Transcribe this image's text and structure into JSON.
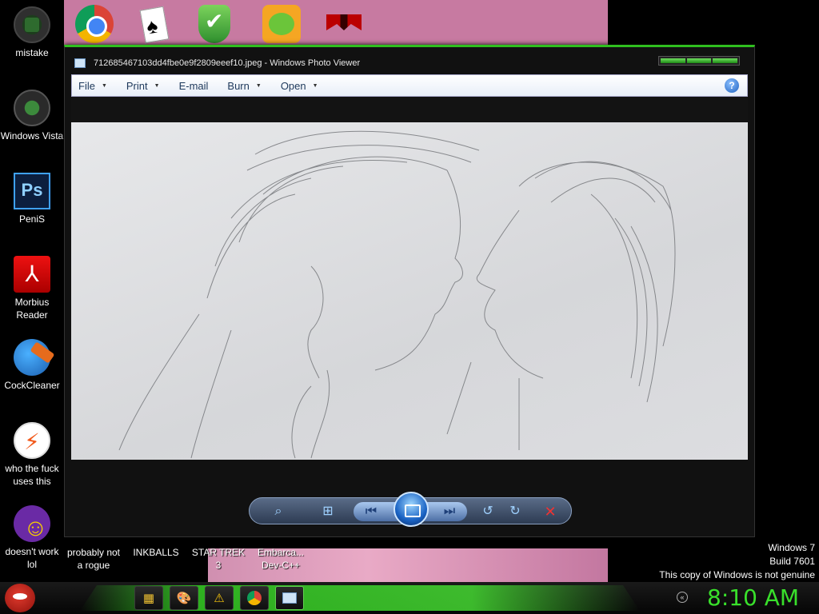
{
  "desktop_left": [
    {
      "label": "mistake",
      "icon": "mistake-icon"
    },
    {
      "label": "Windows Vista",
      "icon": "windows-vista-icon"
    },
    {
      "label": "PeniS",
      "icon": "photoshop-icon"
    },
    {
      "label": "Morbius Reader",
      "icon": "pdf-reader-icon"
    },
    {
      "label": "CockCleaner",
      "icon": "ccleaner-icon"
    },
    {
      "label": "who the fuck uses this",
      "icon": "bolt-app-icon"
    },
    {
      "label": "doesn't work lol",
      "icon": "yahoo-messenger-icon"
    }
  ],
  "desktop_top_icons": [
    "chrome-icon",
    "solitaire-icon",
    "shield-icon",
    "bad-piggies-icon",
    "flag-icon"
  ],
  "bottom_labels": [
    "probably not a rogue",
    "INKBALLS",
    "STAR TREK 3",
    "Embarca... Dev-C++"
  ],
  "window": {
    "title": "712685467103dd4fbe0e9f2809eeef10.jpeg - Windows Photo Viewer",
    "menu": [
      {
        "label": "File",
        "has_caret": true
      },
      {
        "label": "Print",
        "has_caret": true
      },
      {
        "label": "E-mail",
        "has_caret": false
      },
      {
        "label": "Burn",
        "has_caret": true
      },
      {
        "label": "Open",
        "has_caret": true
      }
    ],
    "help": "?"
  },
  "watermark": {
    "line1": "Windows 7",
    "line2": "Build 7601",
    "line3": "This copy of Windows is not genuine"
  },
  "taskbar": {
    "clock": "8:10 AM",
    "buttons": [
      "folder-icon",
      "paint-icon",
      "warning-icon",
      "chrome-icon",
      "photo-viewer-icon"
    ]
  },
  "colors": {
    "accent_green": "#39e02b",
    "menu_text": "#1e395b"
  }
}
